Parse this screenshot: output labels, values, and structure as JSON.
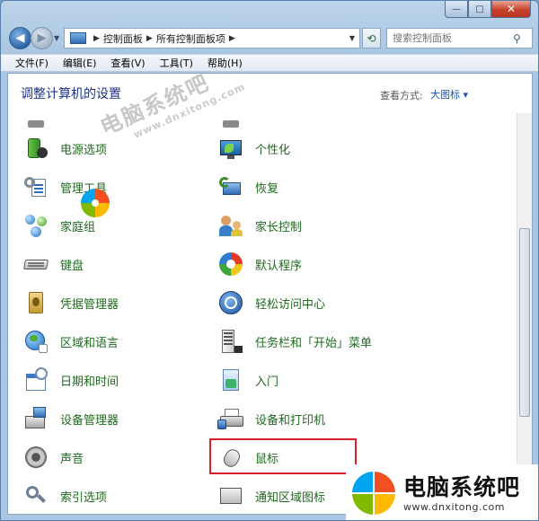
{
  "window": {
    "caption": {
      "minimize": "—",
      "maximize": "□",
      "close": "✕"
    }
  },
  "address_bar": {
    "crumbs": [
      "控制面板",
      "所有控制面板项"
    ],
    "search_placeholder": "搜索控制面板"
  },
  "menu": [
    "文件(F)",
    "编辑(E)",
    "查看(V)",
    "工具(T)",
    "帮助(H)"
  ],
  "header": {
    "title": "调整计算机的设置",
    "view_label": "查看方式:",
    "view_value": "大图标 ▾"
  },
  "items": [
    {
      "label": "电源选项",
      "icon": "power-options-icon"
    },
    {
      "label": "个性化",
      "icon": "personalization-icon"
    },
    {
      "label": "管理工具",
      "icon": "admin-tools-icon"
    },
    {
      "label": "恢复",
      "icon": "recovery-icon"
    },
    {
      "label": "家庭组",
      "icon": "homegroup-icon"
    },
    {
      "label": "家长控制",
      "icon": "parental-controls-icon"
    },
    {
      "label": "键盘",
      "icon": "keyboard-icon"
    },
    {
      "label": "默认程序",
      "icon": "default-programs-icon"
    },
    {
      "label": "凭据管理器",
      "icon": "credential-manager-icon"
    },
    {
      "label": "轻松访问中心",
      "icon": "ease-of-access-icon"
    },
    {
      "label": "区域和语言",
      "icon": "region-language-icon"
    },
    {
      "label": "任务栏和「开始」菜单",
      "icon": "taskbar-start-menu-icon"
    },
    {
      "label": "日期和时间",
      "icon": "date-time-icon"
    },
    {
      "label": "入门",
      "icon": "getting-started-icon"
    },
    {
      "label": "设备管理器",
      "icon": "device-manager-icon"
    },
    {
      "label": "设备和打印机",
      "icon": "devices-printers-icon"
    },
    {
      "label": "声音",
      "icon": "sound-icon"
    },
    {
      "label": "鼠标",
      "icon": "mouse-icon"
    },
    {
      "label": "索引选项",
      "icon": "indexing-options-icon"
    },
    {
      "label": "通知区域图标",
      "icon": "notification-area-icon"
    }
  ],
  "watermark": {
    "text": "电脑系统吧",
    "url": "www.dnxitong.com"
  },
  "colors": {
    "link_green": "#1f6b1f",
    "title_blue": "#1e3287",
    "highlight_red": "#d7202b"
  }
}
